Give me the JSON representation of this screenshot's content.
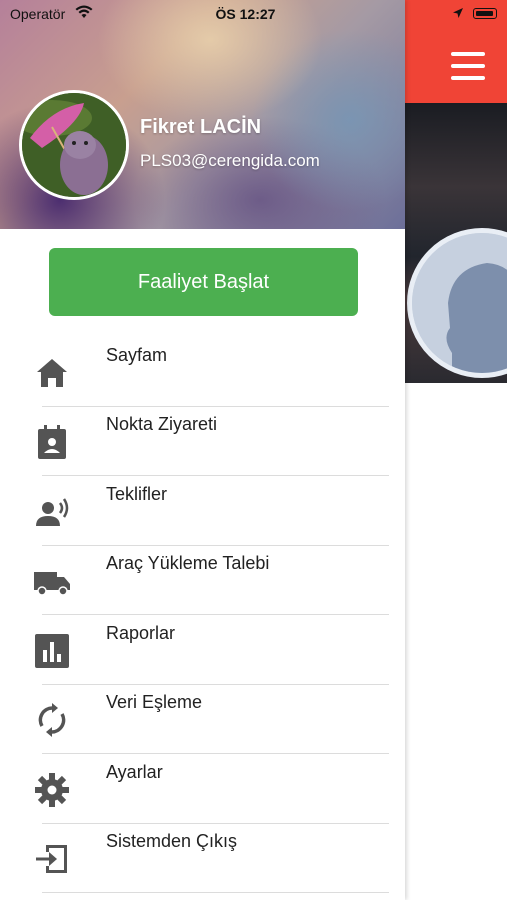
{
  "status_bar": {
    "carrier": "Operatör",
    "time": "ÖS 12:27"
  },
  "profile": {
    "name": "Fikret LACİN",
    "email": "PLS03@cerengida.com"
  },
  "start_button": {
    "label": "Faaliyet Başlat"
  },
  "menu": {
    "items": [
      {
        "label": "Sayfam",
        "icon": "home-icon"
      },
      {
        "label": "Nokta Ziyareti",
        "icon": "visit-clipboard-icon"
      },
      {
        "label": "Teklifler",
        "icon": "speaking-person-icon"
      },
      {
        "label": "Araç Yükleme Talebi",
        "icon": "truck-icon"
      },
      {
        "label": "Raporlar",
        "icon": "bar-chart-icon"
      },
      {
        "label": "Veri Eşleme",
        "icon": "sync-icon"
      },
      {
        "label": "Ayarlar",
        "icon": "gear-icon"
      },
      {
        "label": "Sistemden Çıkış",
        "icon": "logout-icon"
      }
    ]
  },
  "colors": {
    "accent_green": "#4caf50",
    "header_red": "#f04436",
    "icon_gray": "#545454"
  }
}
